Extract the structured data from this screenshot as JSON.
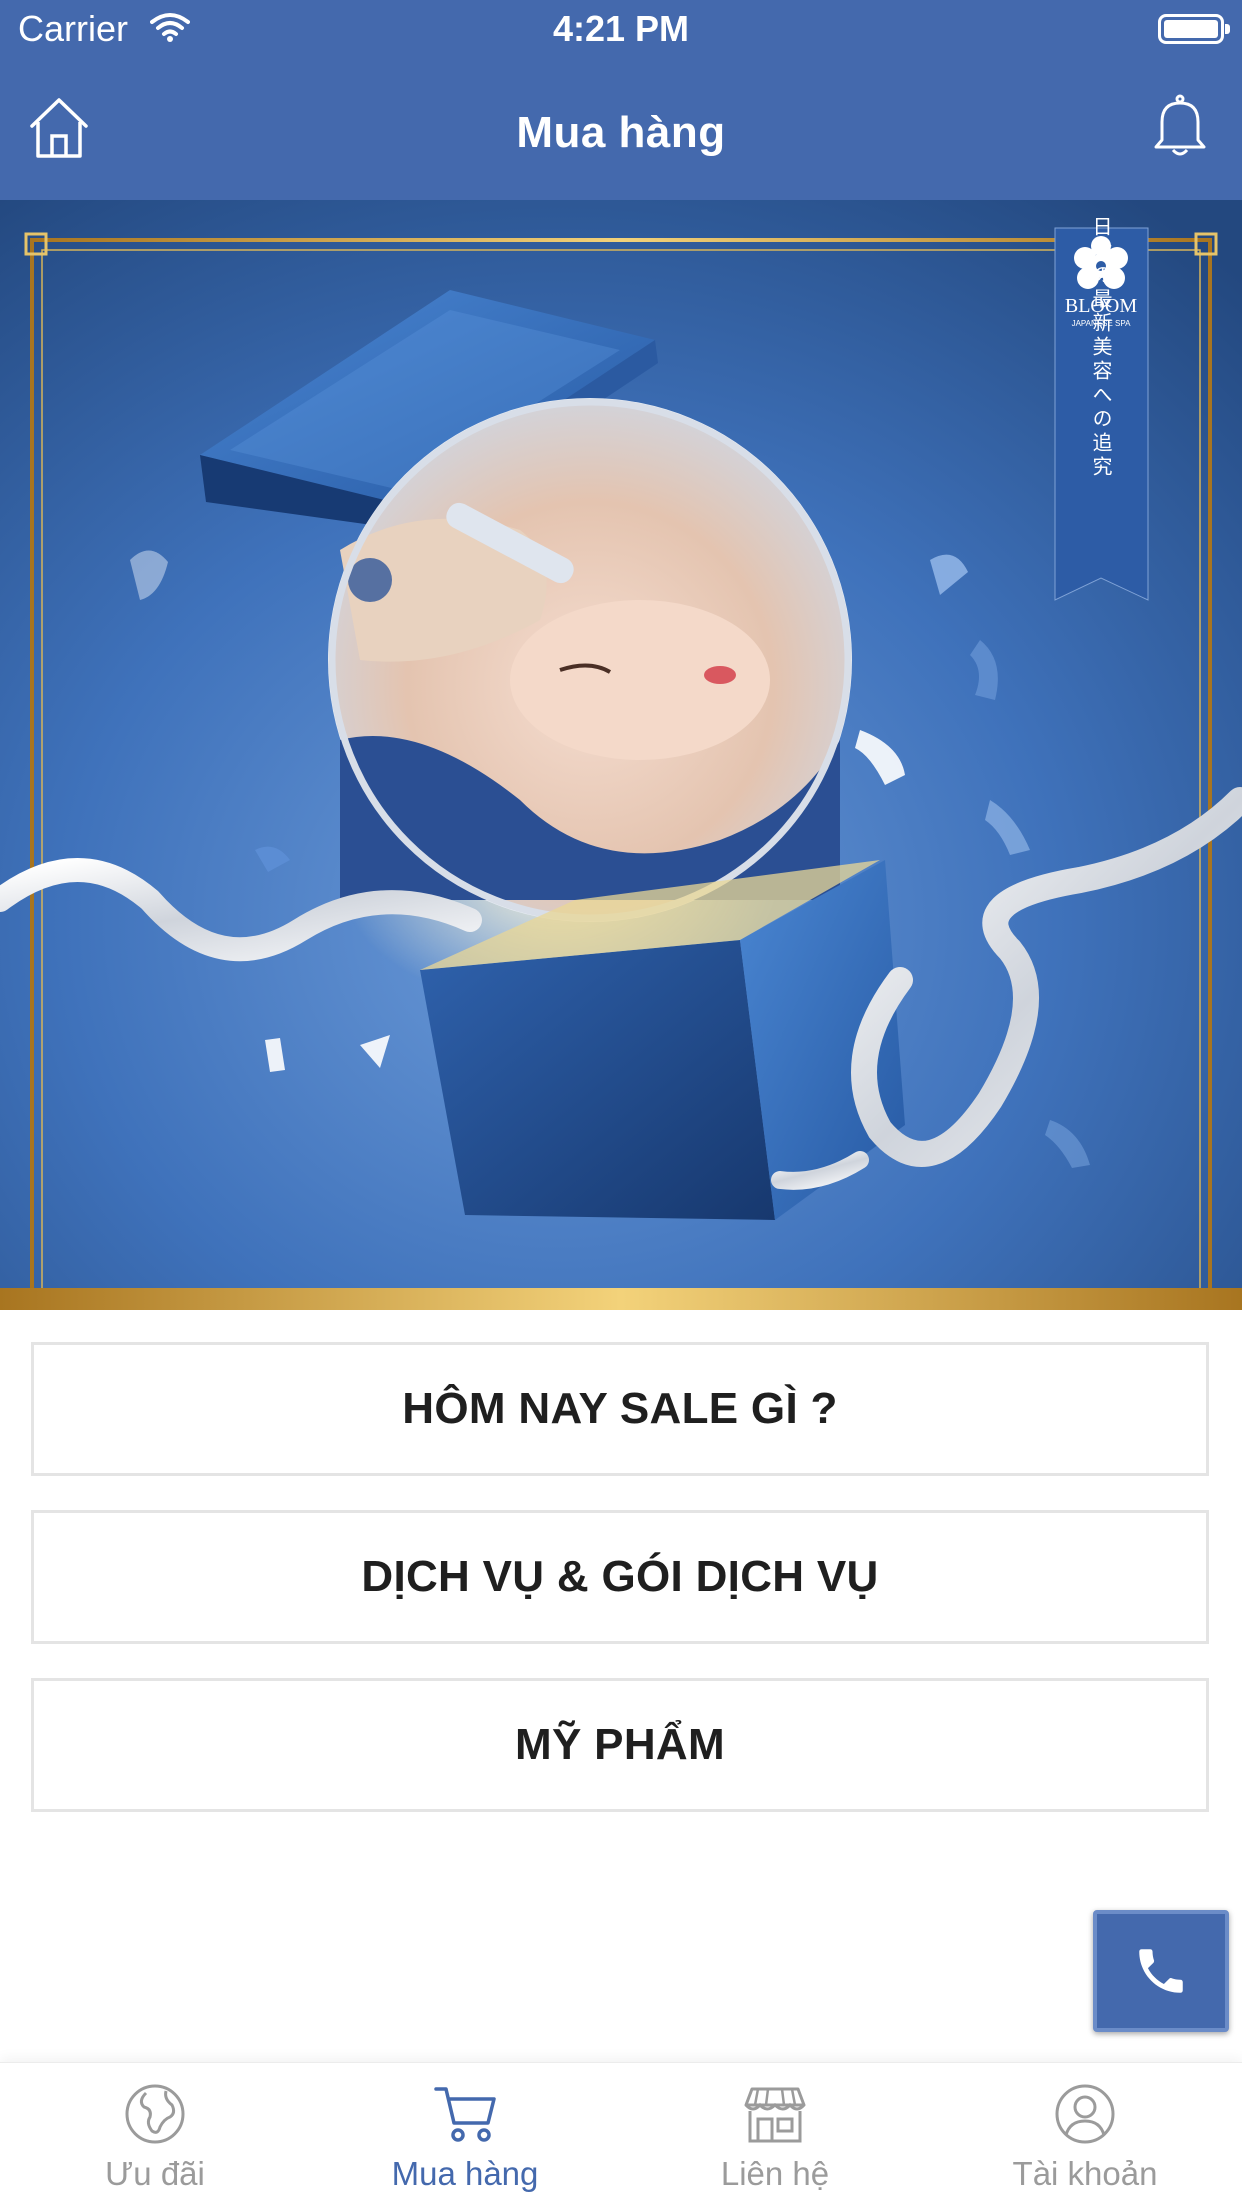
{
  "status_bar": {
    "carrier": "Carrier",
    "time": "4:21 PM"
  },
  "header": {
    "title": "Mua hàng"
  },
  "banner": {
    "brand": "BLOOM",
    "brand_sub": "JAPANESE SPA",
    "vertical_text": "日本の最新美容への追究"
  },
  "menu": {
    "items": [
      {
        "label": "HÔM NAY SALE GÌ ?"
      },
      {
        "label": "DỊCH VỤ & GÓI DỊCH VỤ"
      },
      {
        "label": "MỸ PHẨM"
      }
    ]
  },
  "tabs": [
    {
      "label": "Ưu đãi",
      "icon": "globe-icon",
      "active": false
    },
    {
      "label": "Mua hàng",
      "icon": "cart-icon",
      "active": true
    },
    {
      "label": "Liên hệ",
      "icon": "store-icon",
      "active": false
    },
    {
      "label": "Tài khoản",
      "icon": "user-icon",
      "active": false
    }
  ],
  "colors": {
    "primary": "#4469ad",
    "inactive_tab": "#9b9b9b",
    "gold_frame": "#d4a53a"
  }
}
